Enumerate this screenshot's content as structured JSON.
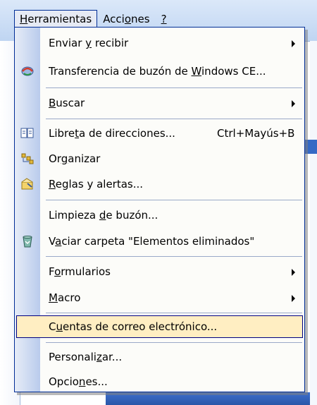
{
  "menubar": {
    "items": [
      {
        "text": "Herramientas",
        "underline": "H"
      },
      {
        "text": "Acciones",
        "underline": "o"
      },
      {
        "text": "?",
        "underline": "?"
      }
    ]
  },
  "menu": {
    "items": [
      {
        "text": "Enviar y recibir",
        "underline": "y",
        "submenu": true,
        "icon": ""
      },
      {
        "text": "Transferencia de buzón de Windows CE...",
        "underline": "W",
        "icon": "sync-icon"
      },
      {
        "text": "Buscar",
        "underline": "B",
        "submenu": true,
        "icon": ""
      },
      {
        "text": "Libreta de direcciones...",
        "underline": "t",
        "shortcut": "Ctrl+Mayús+B",
        "icon": "address-book-icon"
      },
      {
        "text": "Organizar",
        "underline": "g",
        "icon": "organize-icon"
      },
      {
        "text": "Reglas y alertas...",
        "underline": "R",
        "icon": "rules-alerts-icon"
      },
      {
        "text": "Limpieza de buzón...",
        "underline": "d",
        "icon": ""
      },
      {
        "text": "Vaciar carpeta \"Elementos eliminados\"",
        "underline": "a",
        "icon": "trash-icon"
      },
      {
        "text": "Formularios",
        "underline": "o",
        "submenu": true,
        "icon": ""
      },
      {
        "text": "Macro",
        "underline": "M",
        "submenu": true,
        "icon": ""
      },
      {
        "text": "Cuentas de correo electrónico...",
        "underline": "u",
        "highlighted": true,
        "icon": ""
      },
      {
        "text": "Personalizar...",
        "underline": "z",
        "icon": ""
      },
      {
        "text": "Opciones...",
        "underline": "n",
        "icon": ""
      }
    ]
  },
  "colors": {
    "menu_border": "#002d96",
    "highlight_fill": "#ffeec2",
    "highlight_border": "#000080",
    "gutter_start": "#e6ecf7",
    "gutter_end": "#b9cbec"
  }
}
